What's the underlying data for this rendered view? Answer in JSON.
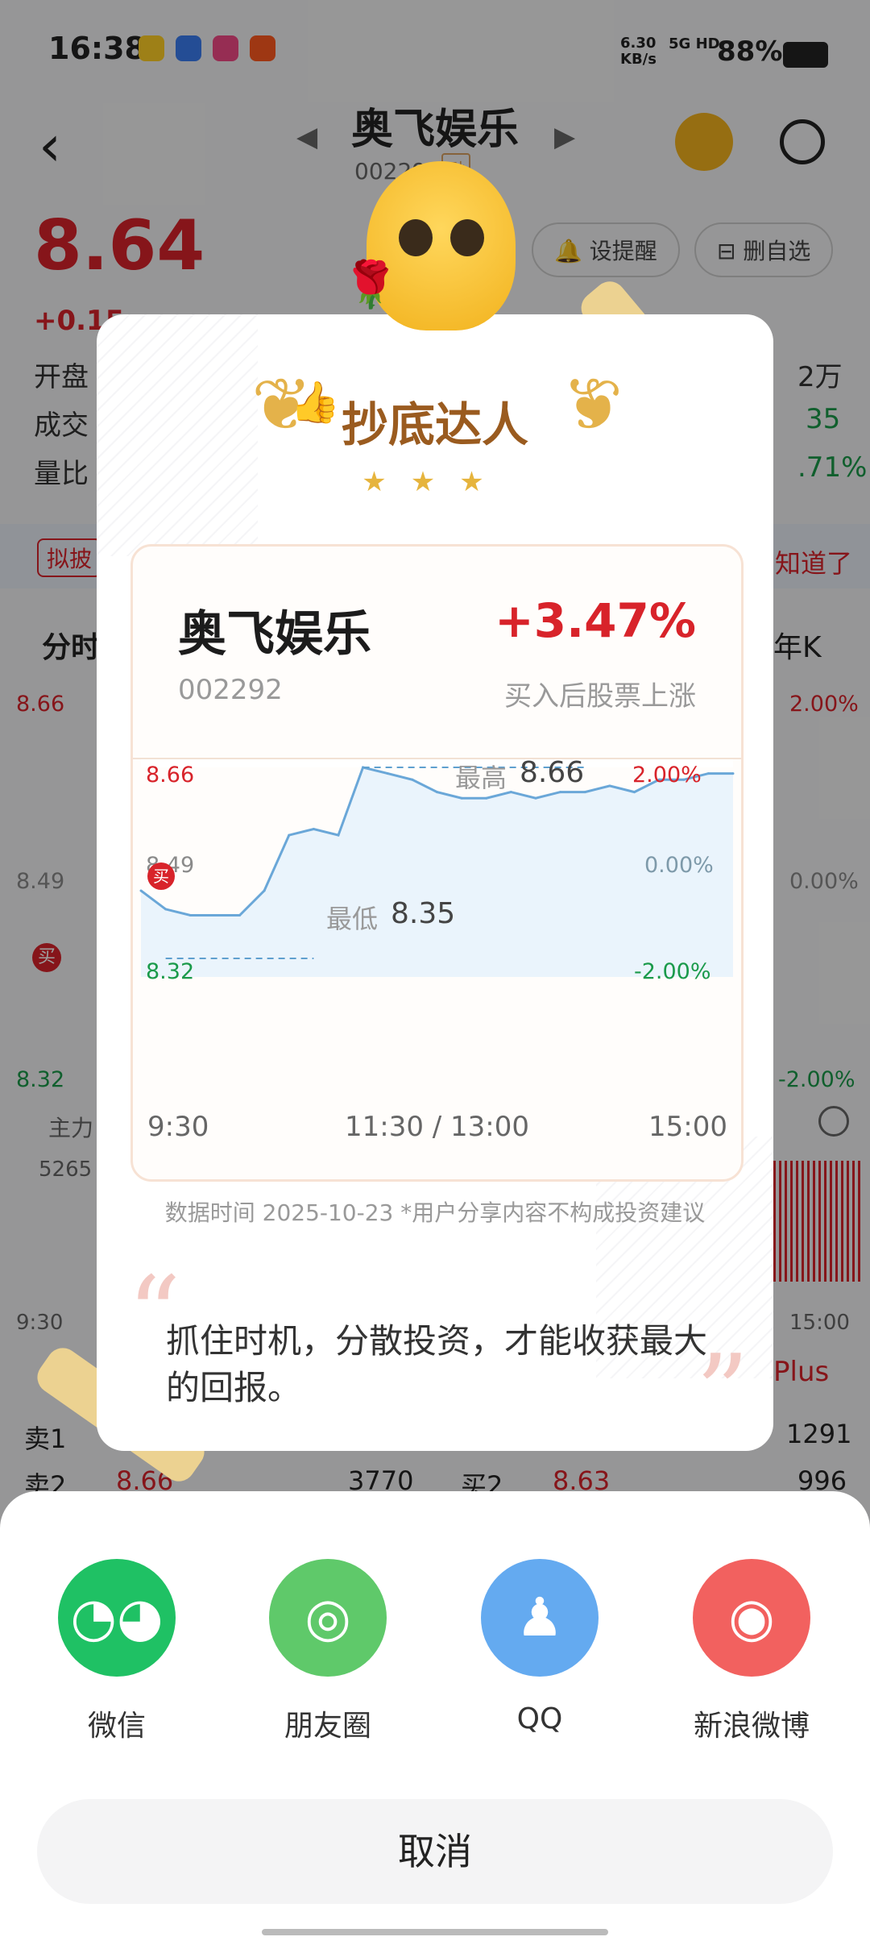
{
  "status_bar": {
    "time": "16:38",
    "net_speed": "6.30 KB/s",
    "signal": "5G HD",
    "battery": "88%"
  },
  "header": {
    "title": "奥飞娱乐",
    "code": "002292",
    "margin_tag": "融",
    "price": "8.64",
    "change": "+0.15",
    "set_alert": "设提醒",
    "remove_watch": "删自选"
  },
  "background": {
    "left_labels": [
      "开盘",
      "成交",
      "量比"
    ],
    "right_values": [
      "2万",
      "35",
      ".71%"
    ],
    "notice_tag": "拟披",
    "notice_action": "知道了",
    "tab_left": "分时",
    "tab_right": "年K",
    "chart_left_ticks": [
      "8.66",
      "8.49",
      "8.32"
    ],
    "chart_right_ticks": [
      "2.00%",
      "0.00%",
      "-2.00%"
    ],
    "flow_label": "主力",
    "volume_value": "5265",
    "time_start": "9:30",
    "time_end": "15:00",
    "plus_label": "Plus",
    "orderbook": [
      {
        "side": "卖1",
        "price": "",
        "qty": "",
        "bid_side": "",
        "bid_price": "",
        "bid_qty": "1291"
      },
      {
        "side": "卖2",
        "price": "8.66",
        "qty": "3770",
        "bid_side": "买2",
        "bid_price": "8.63",
        "bid_qty": "996"
      }
    ],
    "buy_marker": "买"
  },
  "card": {
    "badge_title": "抄底达人",
    "stock_name": "奥飞娱乐",
    "stock_code": "002292",
    "change_pct": "+3.47%",
    "description": "买入后股票上涨",
    "high_label": "最高",
    "high_value": "8.66",
    "low_label": "最低",
    "low_value": "8.35",
    "buy_marker": "买",
    "data_note": "数据时间 2025-10-23    *用户分享内容不构成投资建议",
    "quote": "抓住时机，分散投资，才能收获最大的回报。"
  },
  "chart_data": {
    "type": "line",
    "y_left_ticks": [
      "8.66",
      "8.49",
      "8.32"
    ],
    "y_right_ticks": [
      "2.00%",
      "0.00%",
      "-2.00%"
    ],
    "x_ticks": [
      "9:30",
      "11:30 / 13:00",
      "15:00"
    ],
    "ylim": [
      8.32,
      8.66
    ],
    "baseline": 8.49,
    "x": [
      0,
      10,
      20,
      30,
      40,
      50,
      60,
      70,
      80,
      90,
      100,
      110,
      120,
      130,
      140,
      150,
      160,
      170,
      180,
      190,
      200,
      210,
      220,
      230,
      240
    ],
    "y": [
      8.46,
      8.43,
      8.42,
      8.42,
      8.42,
      8.46,
      8.55,
      8.56,
      8.55,
      8.66,
      8.65,
      8.64,
      8.62,
      8.61,
      8.61,
      8.62,
      8.61,
      8.62,
      8.62,
      8.63,
      8.62,
      8.64,
      8.64,
      8.65,
      8.65
    ],
    "high": 8.66,
    "low": 8.35,
    "line_color": "#6aa7d8",
    "fill_color": "#eaf4fc"
  },
  "share": {
    "items": [
      {
        "label": "微信",
        "color": "#1fc164",
        "icon": "wechat-icon"
      },
      {
        "label": "朋友圈",
        "color": "#5fc96a",
        "icon": "moments-icon"
      },
      {
        "label": "QQ",
        "color": "#64aaf0",
        "icon": "qq-icon"
      },
      {
        "label": "新浪微博",
        "color": "#f2615f",
        "icon": "weibo-icon"
      }
    ],
    "cancel": "取消"
  }
}
